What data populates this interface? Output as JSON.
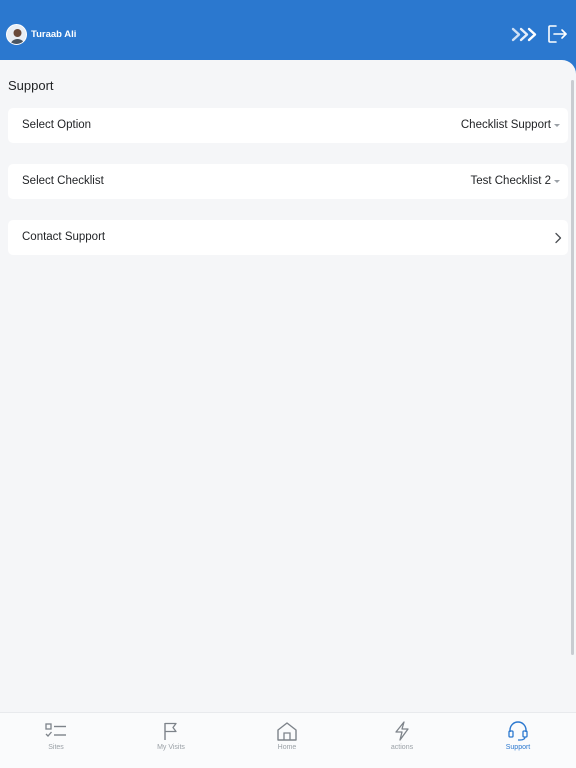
{
  "header": {
    "user_name": "Turaab Ali",
    "forward_icon": "triple-chevron-right-icon",
    "logout_icon": "logout-icon",
    "brand_color": "#2b78cf"
  },
  "page": {
    "title": "Support",
    "rows": [
      {
        "label": "Select Option",
        "value": "Checklist Support",
        "type": "dropdown"
      },
      {
        "label": "Select Checklist",
        "value": "Test Checklist 2",
        "type": "dropdown"
      },
      {
        "label": "Contact Support",
        "value": "",
        "type": "link"
      }
    ]
  },
  "tabbar": {
    "tabs": [
      {
        "label": "Sites",
        "icon": "checklist-icon",
        "active": false
      },
      {
        "label": "My Visits",
        "icon": "flag-icon",
        "active": false
      },
      {
        "label": "Home",
        "icon": "home-icon",
        "active": false
      },
      {
        "label": "actions",
        "icon": "lightning-icon",
        "active": false
      },
      {
        "label": "Support",
        "icon": "headset-icon",
        "active": true
      }
    ]
  }
}
